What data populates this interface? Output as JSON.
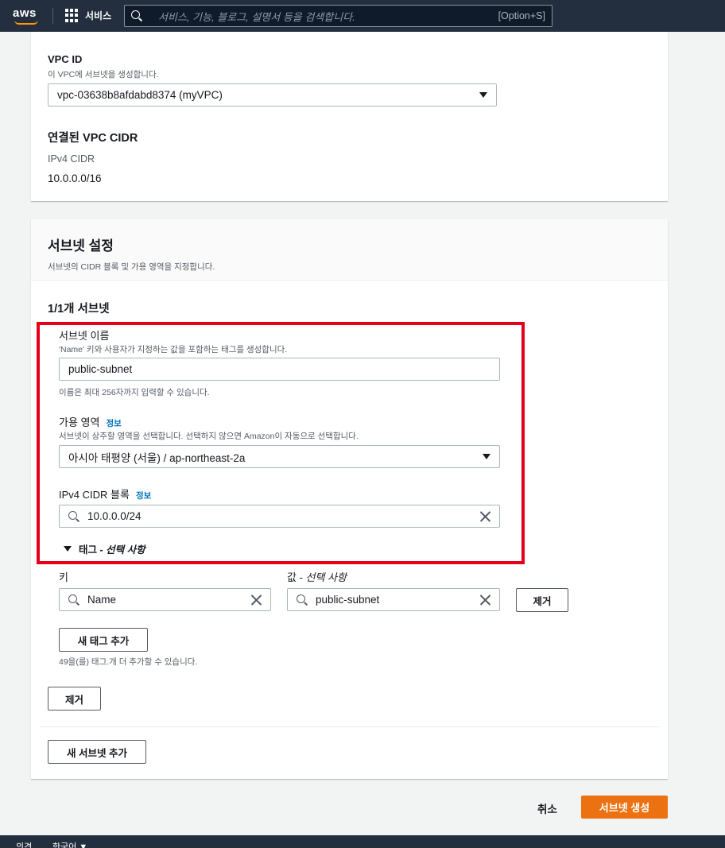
{
  "nav": {
    "logo": "aws",
    "services_label": "서비스",
    "search_placeholder": "서비스, 기능, 블로그, 설명서 등을 검색합니다.",
    "search_shortcut": "[Option+S]"
  },
  "vpc": {
    "vpc_id_label": "VPC ID",
    "vpc_id_desc": "이 VPC에 서브넷을 생성합니다.",
    "vpc_id_value": "vpc-03638b8afdabd8374 (myVPC)",
    "cidr_heading": "연결된 VPC CIDR",
    "ipv4_cidr_label": "IPv4 CIDR",
    "ipv4_cidr_value": "10.0.0.0/16"
  },
  "subnet_settings": {
    "title": "서브넷 설정",
    "desc": "서브넷의 CIDR 블록 및 가용 영역을 지정합니다.",
    "count_heading": "1/1개 서브넷",
    "name_label": "서브넷 이름",
    "name_desc": "'Name' 키와 사용자가 지정하는 값을 포함하는 태그를 생성합니다.",
    "name_value": "public-subnet",
    "name_hint": "이름은 최대 256자까지 입력할 수 있습니다.",
    "az_label": "가용 영역",
    "az_info": "정보",
    "az_desc": "서브넷이 상주할 영역을 선택합니다. 선택하지 않으면 Amazon이 자동으로 선택합니다.",
    "az_value": "아시아 태평양 (서울) / ap-northeast-2a",
    "cidr_label": "IPv4 CIDR 블록",
    "cidr_info": "정보",
    "cidr_value": "10.0.0.0/24",
    "tags_toggle_prefix": "태그 - ",
    "tags_toggle_optional": "선택 사항",
    "key_label": "키",
    "value_label_prefix": "값 - ",
    "value_label_optional": "선택 사항",
    "tag_key": "Name",
    "tag_value": "public-subnet",
    "remove_tag_button": "제거",
    "add_tag_button": "새 태그 추가",
    "tags_remaining": "49을(를) 태그.개 더 추가할 수 있습니다.",
    "remove_subnet_button": "제거",
    "add_subnet_button": "새 서브넷 추가"
  },
  "actions": {
    "cancel": "취소",
    "create": "서브넷 생성"
  },
  "footer": {
    "feedback": "의견",
    "language": "한국어 ▼"
  }
}
